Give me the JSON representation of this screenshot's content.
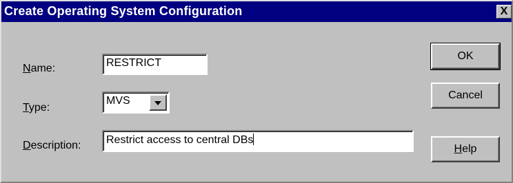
{
  "window": {
    "title": "Create Operating System Configuration",
    "close_label": "X"
  },
  "form": {
    "name_label_accel": "N",
    "name_label_rest": "ame:",
    "name_value": "RESTRICT",
    "type_label_accel": "T",
    "type_label_rest": "ype:",
    "type_value": "MVS",
    "description_label_accel": "D",
    "description_label_rest": "escription:",
    "description_value": "Restrict access to central DBs"
  },
  "buttons": {
    "ok_label": "OK",
    "cancel_label": "Cancel",
    "help_accel": "H",
    "help_rest": "elp"
  },
  "icons": {
    "close": "close-icon",
    "dropdown": "chevron-down-icon"
  }
}
